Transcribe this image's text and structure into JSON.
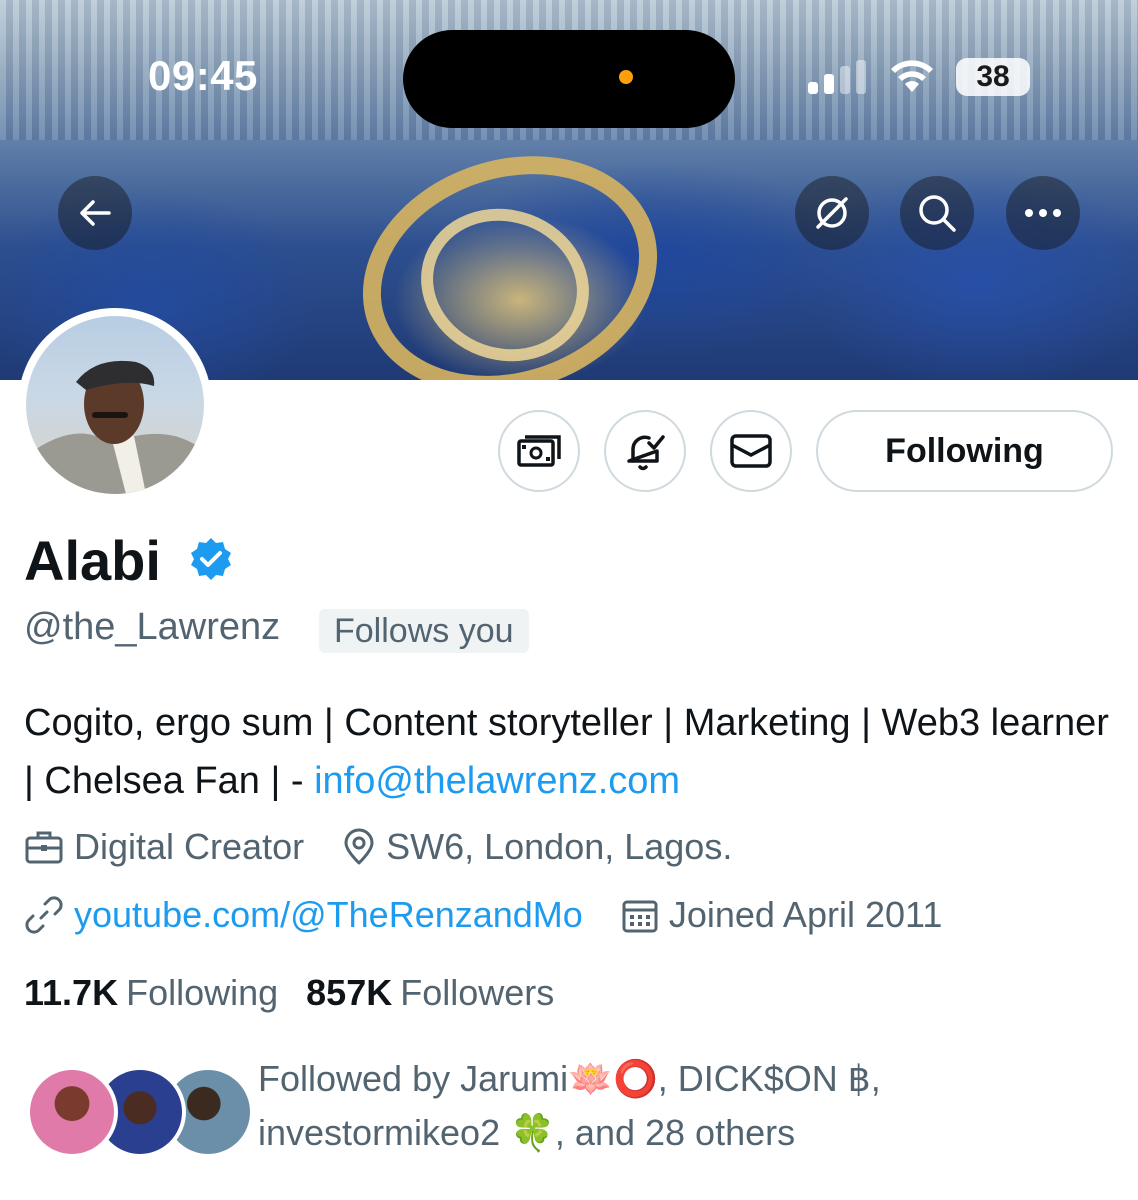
{
  "status_bar": {
    "time": "09:45",
    "battery": "38",
    "icons": [
      "signal-icon",
      "wifi-icon",
      "battery-icon"
    ]
  },
  "banner": {
    "controls": [
      "back-arrow-icon",
      "grok-icon",
      "search-icon",
      "more-icon"
    ]
  },
  "actions": {
    "icons": [
      "tip-money-icon",
      "notification-bell-icon",
      "mail-icon"
    ],
    "following_label": "Following"
  },
  "profile": {
    "name": "Alabi",
    "handle": "@the_Lawrenz",
    "follows_you": "Follows you",
    "bio_text": "Cogito, ergo sum | Content storyteller | Marketing | Web3 learner | Chelsea Fan | - ",
    "bio_link": "info@thelawrenz.com",
    "category": "Digital Creator",
    "location": "SW6, London, Lagos.",
    "website": "youtube.com/@TheRenzandMo",
    "joined": "Joined April 2011"
  },
  "stats": {
    "following_count": "11.7K",
    "following_label": "Following",
    "followers_count": "857K",
    "followers_label": "Followers"
  },
  "followed_by": {
    "text_line1": "Followed by Jarumi🪷⭕️, DICK$ON ฿,",
    "text_line2": "investormikeo2 🍀, and 28 others"
  },
  "colors": {
    "accent": "#1d9bf0",
    "text_primary": "#0f1419",
    "text_secondary": "#536471",
    "border": "#cfd9de"
  }
}
